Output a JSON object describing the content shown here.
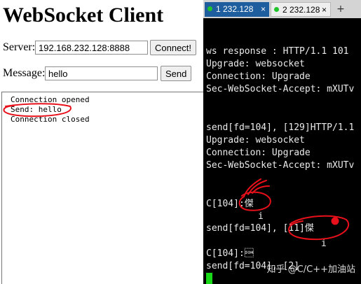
{
  "browser": {
    "title": "WebSocket Client",
    "server_label": "Server:",
    "server_value": "192.168.232.128:8888",
    "connect_label": "Connect!",
    "message_label": "Message:",
    "message_value": "hello",
    "send_label": "Send",
    "log": [
      "Connection opened",
      "Send: hello",
      "Connection closed"
    ]
  },
  "terminal": {
    "tabs": [
      {
        "label": "1 232.128",
        "close": "×",
        "active": true
      },
      {
        "label": "2 232.128",
        "close": "×",
        "active": false
      }
    ],
    "add_tab": "+",
    "lines": [
      "ws response : HTTP/1.1 101",
      "Upgrade: websocket",
      "Connection: Upgrade",
      "Sec-WebSocket-Accept: mXUTv",
      "send[fd=104], [129]HTTP/1.1",
      "Upgrade: websocket",
      "Connection: Upgrade",
      "Sec-WebSocket-Accept: mXUTv",
      "C[104]:傑",
      "i",
      "send[fd=104], [11]傑",
      "i",
      "C[104]:\u0001",
      "send[fd=104], [2]"
    ],
    "watermark": "知乎 @C/C++加油站",
    "annotation_color": "#e8101a",
    "cursor_color": "#19d919"
  }
}
